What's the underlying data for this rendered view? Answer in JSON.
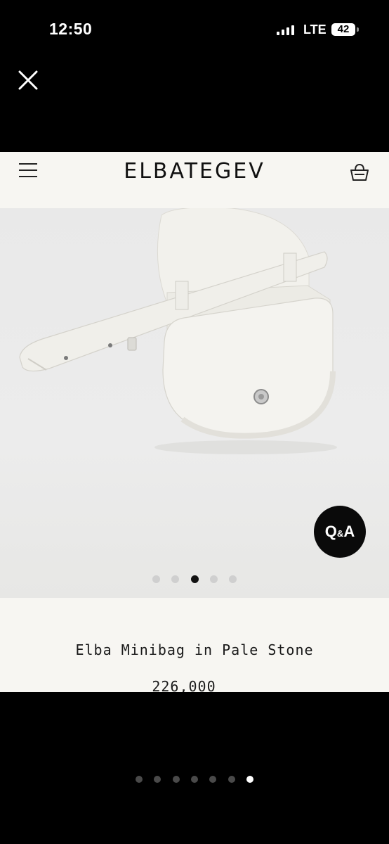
{
  "status_bar": {
    "time": "12:50",
    "network": "LTE",
    "battery": "42",
    "signal_bars": 4
  },
  "viewer": {
    "close_icon": "close-icon"
  },
  "site": {
    "logo": "ELBATEGEV",
    "menu_icon": "hamburger-menu-icon",
    "cart_icon": "shopping-bag-icon",
    "background_color": "#f7f6f2"
  },
  "product": {
    "name": "Elba Minibag in Pale Stone",
    "price": "226,000",
    "image_alt": "white leather mini bag with belt strap",
    "carousel_total": 5,
    "carousel_active": 3
  },
  "qa_button": {
    "label_q": "Q",
    "label_amp": "&",
    "label_a": "A"
  },
  "page_indicator": {
    "total": 7,
    "active": 7
  }
}
